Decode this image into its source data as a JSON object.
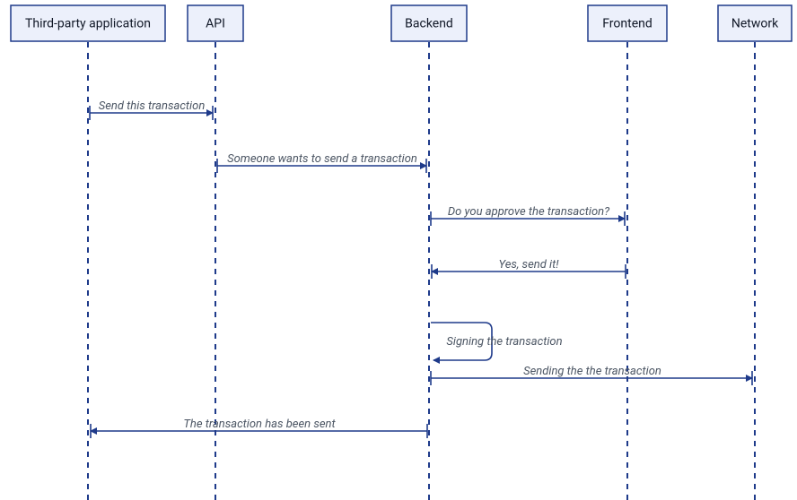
{
  "diagram": {
    "type": "sequence",
    "participants": [
      {
        "id": "third_party",
        "label": "Third-party application"
      },
      {
        "id": "api",
        "label": "API"
      },
      {
        "id": "backend",
        "label": "Backend"
      },
      {
        "id": "frontend",
        "label": "Frontend"
      },
      {
        "id": "network",
        "label": "Network"
      }
    ],
    "messages": [
      {
        "id": "m1",
        "label": "Send this transaction"
      },
      {
        "id": "m2",
        "label": "Someone wants to send a transaction"
      },
      {
        "id": "m3",
        "label": "Do you approve the transaction?"
      },
      {
        "id": "m4",
        "label": "Yes, send it!"
      },
      {
        "id": "m5",
        "label": "Signing the transaction"
      },
      {
        "id": "m6",
        "label": "Sending the the transaction"
      },
      {
        "id": "m7",
        "label": "The transaction has been sent"
      }
    ]
  },
  "colors": {
    "stroke": "#1e3a8a",
    "box_fill": "#ecf0fb",
    "text": "#4b5563"
  }
}
